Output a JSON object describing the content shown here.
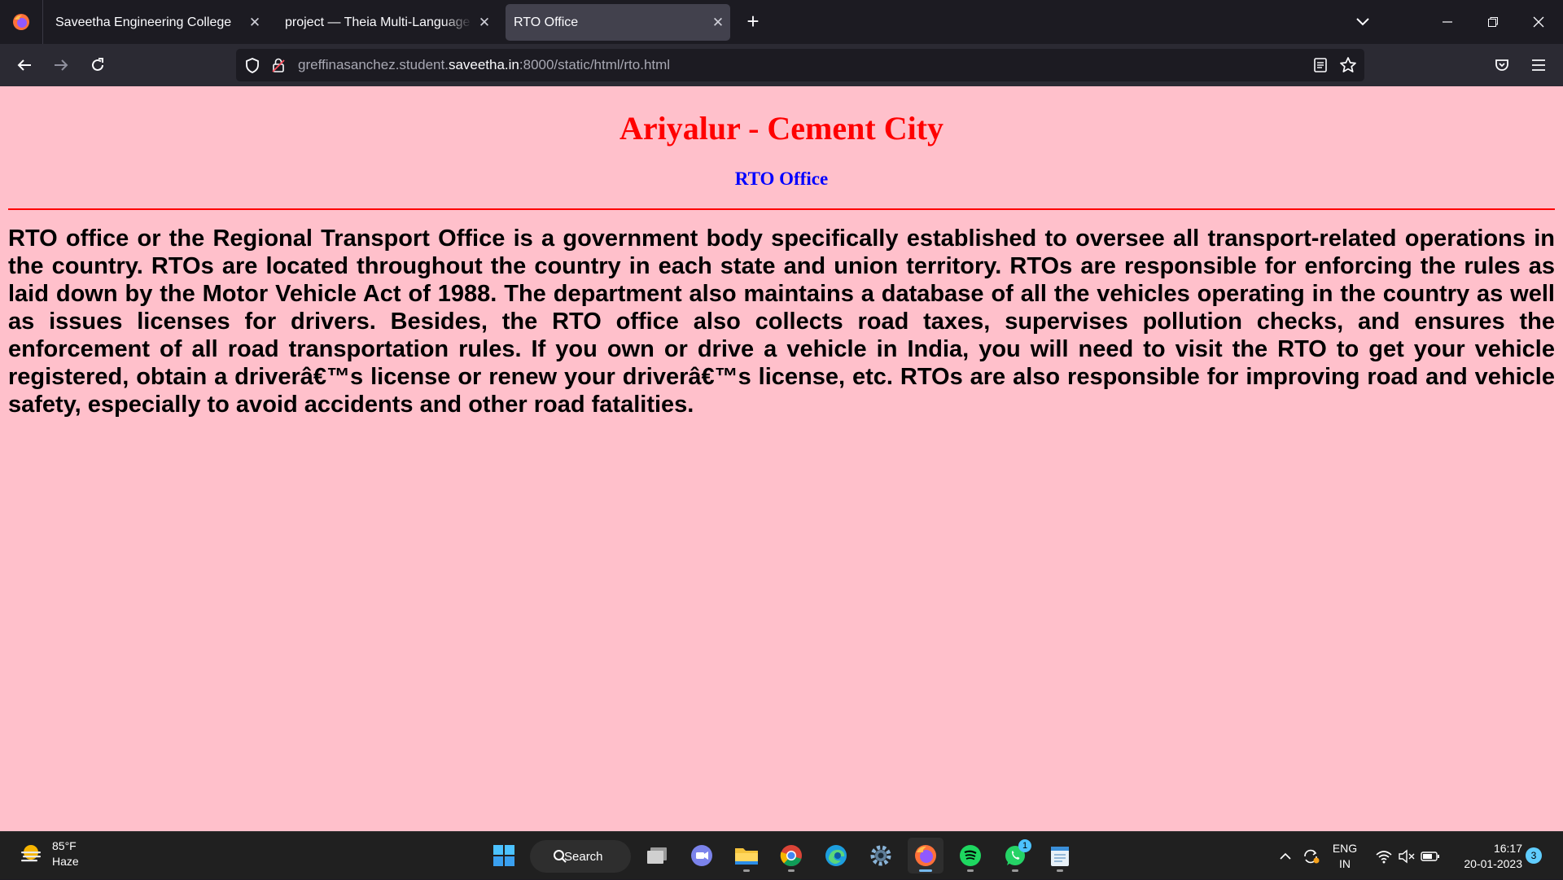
{
  "browser": {
    "tabs": [
      {
        "title": "Saveetha Engineering College",
        "active": false
      },
      {
        "title": "project — Theia Multi-Language Explorer",
        "active": false
      },
      {
        "title": "RTO Office",
        "active": true
      }
    ],
    "url": {
      "prefix": "greffinasanchez.student.",
      "domain": "saveetha.in",
      "suffix": ":8000/static/html/rto.html"
    }
  },
  "page": {
    "heading": "Ariyalur - Cement City",
    "subheading": "RTO Office",
    "body": "RTO office or the Regional Transport Office is a government body specifically established to oversee all transport-related operations in the country. RTOs are located throughout the country in each state and union territory. RTOs are responsible for enforcing the rules as laid down by the Motor Vehicle Act of 1988. The department also maintains a database of all the vehicles operating in the country as well as issues licenses for drivers. Besides, the RTO office also collects road taxes, supervises pollution checks, and ensures the enforcement of all road transportation rules. If you own or drive a vehicle in India, you will need to visit the RTO to get your vehicle registered, obtain a driverâ€™s license or renew your driverâ€™s license, etc. RTOs are also responsible for improving road and vehicle safety, especially to avoid accidents and other road fatalities.",
    "colors": {
      "background": "#ffc0cb",
      "heading": "#ff0000",
      "subheading": "#0000ff",
      "rule": "#ff0000"
    }
  },
  "taskbar": {
    "weather": {
      "temp": "85°F",
      "condition": "Haze"
    },
    "search_label": "Search",
    "apps": [
      "windows-start-icon",
      "task-view-icon",
      "teams-chat-icon",
      "file-explorer-icon",
      "chrome-icon",
      "edge-icon",
      "settings-icon",
      "firefox-icon",
      "spotify-icon",
      "whatsapp-icon",
      "notepad-icon"
    ],
    "whatsapp_badge": "1",
    "lang": {
      "line1": "ENG",
      "line2": "IN"
    },
    "time": "16:17",
    "date": "20-01-2023",
    "notifications": "3"
  }
}
